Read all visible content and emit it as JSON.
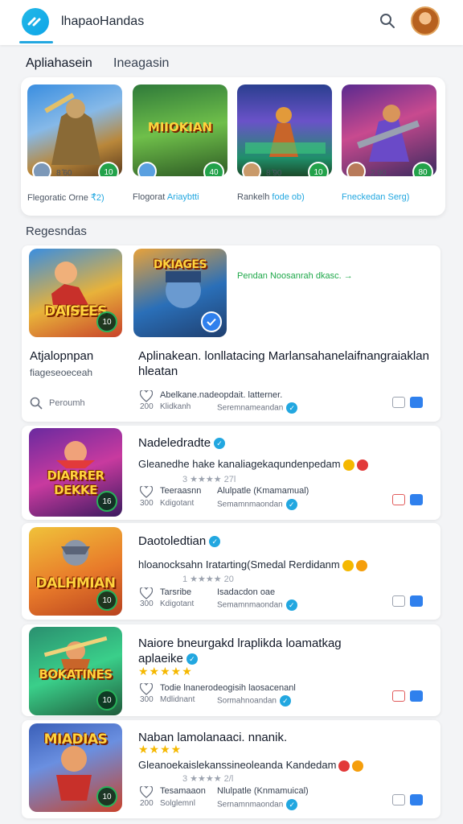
{
  "header": {
    "title": "lhapaoHandas"
  },
  "tabs": [
    {
      "label": "Apliahasein"
    },
    {
      "label": "Ineagasin"
    }
  ],
  "featured": [
    {
      "caption_a": "Flegoratic Orne",
      "caption_b": "₹̂2)",
      "meta": "8 ̂60",
      "badge": "10"
    },
    {
      "caption_a": "Flogorat",
      "caption_b": "Ariaybtti",
      "meta": "",
      "badge": "40",
      "art_text": "MIIOKIAN"
    },
    {
      "caption_a": "Rankelh",
      "caption_b": "fode ob)",
      "meta": "8 ̂90",
      "badge": "10"
    },
    {
      "caption_a": "Fneckedan Serg)",
      "caption_b": "",
      "meta": "2 90",
      "badge": "80"
    }
  ],
  "section": {
    "title": "Regesndas"
  },
  "cards": [
    {
      "left_title": "Atjalopnpan",
      "left_sub": "fiageseoeceah",
      "search_label": "Peroumh",
      "title": "Aplinakean. lonllatacing Marlansahanelaifnangraiaklan hleatan",
      "cta": "Pendan Noosanrah dkasc. →",
      "footer_a": "Abelkane.nadeopdait. latterner.",
      "footer_b": "Klidkanh",
      "footer_c": "Seremnameandan",
      "footer_num": "200",
      "thumb_label": "DAISEES",
      "thumb2_label": "DKIAGES",
      "badge": "10"
    },
    {
      "title": "Nadeledradte",
      "desc": "Gleanedhe hake kanaliagekaqundenpedam",
      "rating_text": "3 ★★★★ 27l",
      "footer_a": "Teeraasnn",
      "footer_a2": "Alulpatle (Kmamamual)",
      "footer_b": "Kdigotant",
      "footer_c": "Semamnmaondan",
      "footer_num": "300",
      "thumb_label": "DIARRER DEKKE",
      "badge": "16"
    },
    {
      "title": "Daotoledtian",
      "desc": "hloanocksahn Iratarting(Smedal Rerdidanm",
      "rating_text": "1 ★★★★ 20",
      "footer_a": "Tarsribe",
      "footer_a2": "Isadacdon oae",
      "footer_b": "Kdigotant",
      "footer_c": "Semamnmaondan",
      "footer_num": "300",
      "thumb_label": "DALHMIAN",
      "badge": "10"
    },
    {
      "title": "Naiore bneurgakd lraplikda loamatkag aplaeike",
      "stars": "★★★★★",
      "footer_a": "Todie lnanerodeogisih laosacenanl",
      "footer_b": "Mdlidnant",
      "footer_c": "Sormahnoandan",
      "footer_num": "300",
      "thumb_label": "BOKATINES",
      "badge": "10"
    },
    {
      "title": "Naban lamolanaaci. nnanik.",
      "stars": "★★★★",
      "desc": "Gleanoekaislekanssineoleanda Kandedam",
      "rating_text": "3 ★★★★ 2/l",
      "footer_a": "Tesamaaon",
      "footer_a2": "Nlulpatle (Knmamuical)",
      "footer_b": "Solglemnl",
      "footer_c": "Sernamnmaondan",
      "footer_num": "200",
      "thumb_label": "MIADIAS",
      "badge": "10"
    }
  ],
  "colors": {
    "accent": "#22a7e0",
    "green": "#22a24a",
    "star": "#f5b800"
  }
}
